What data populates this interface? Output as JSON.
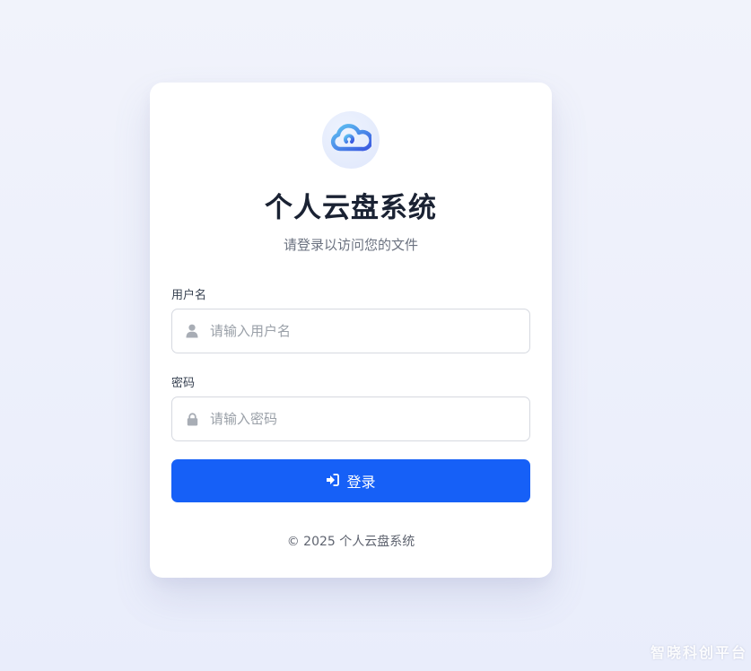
{
  "app": {
    "title": "个人云盘系统",
    "subtitle": "请登录以访问您的文件",
    "logo_icon": "cloud-icon"
  },
  "form": {
    "username_label": "用户名",
    "username_placeholder": "请输入用户名",
    "username_value": "",
    "username_icon": "user-icon",
    "password_label": "密码",
    "password_placeholder": "请输入密码",
    "password_value": "",
    "password_icon": "lock-icon",
    "submit_label": "登录",
    "submit_icon": "sign-in-icon"
  },
  "footer": {
    "copyright": "© 2025 个人云盘系统"
  },
  "watermark": "智晓科创平台",
  "colors": {
    "accent": "#1660f7",
    "background": "#eef1fb",
    "title": "#1a2233"
  }
}
